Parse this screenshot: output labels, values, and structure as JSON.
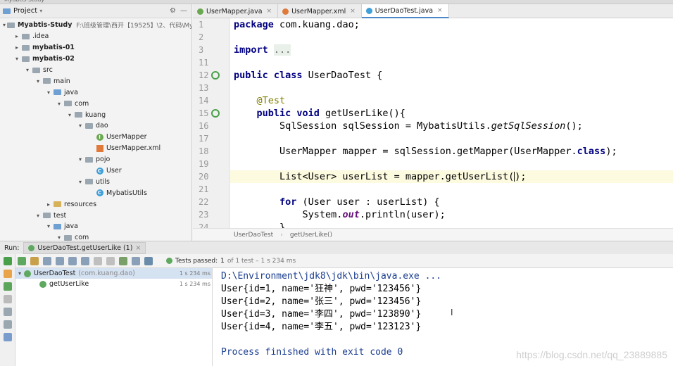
{
  "project_panel": {
    "title": "Project",
    "tree": [
      {
        "label": "Myabtis-Study",
        "path": "F:\\班级管理\\西开【19525】\\2、代码\\My",
        "bold": true,
        "indent": 0,
        "arrow": "▾",
        "icon": "folder"
      },
      {
        "label": ".idea",
        "indent": 1,
        "arrow": "▸",
        "icon": "folder"
      },
      {
        "label": "mybatis-01",
        "bold": true,
        "indent": 1,
        "arrow": "▸",
        "icon": "folder"
      },
      {
        "label": "mybatis-02",
        "bold": true,
        "indent": 1,
        "arrow": "▾",
        "icon": "folder"
      },
      {
        "label": "src",
        "indent": 2,
        "arrow": "▾",
        "icon": "folder"
      },
      {
        "label": "main",
        "indent": 3,
        "arrow": "▾",
        "icon": "folder"
      },
      {
        "label": "java",
        "indent": 4,
        "arrow": "▾",
        "icon": "folder-blue"
      },
      {
        "label": "com",
        "indent": 5,
        "arrow": "▾",
        "icon": "folder"
      },
      {
        "label": "kuang",
        "indent": 6,
        "arrow": "▾",
        "icon": "folder"
      },
      {
        "label": "dao",
        "indent": 7,
        "arrow": "▾",
        "icon": "folder"
      },
      {
        "label": "UserMapper",
        "indent": 8,
        "arrow": "",
        "icon": "interface"
      },
      {
        "label": "UserMapper.xml",
        "indent": 8,
        "arrow": "",
        "icon": "xml"
      },
      {
        "label": "pojo",
        "indent": 7,
        "arrow": "▾",
        "icon": "folder"
      },
      {
        "label": "User",
        "indent": 8,
        "arrow": "",
        "icon": "class"
      },
      {
        "label": "utils",
        "indent": 7,
        "arrow": "▾",
        "icon": "folder"
      },
      {
        "label": "MybatisUtils",
        "indent": 8,
        "arrow": "",
        "icon": "class"
      },
      {
        "label": "resources",
        "indent": 4,
        "arrow": "▸",
        "icon": "folder-yellow"
      },
      {
        "label": "test",
        "indent": 3,
        "arrow": "▾",
        "icon": "folder"
      },
      {
        "label": "java",
        "indent": 4,
        "arrow": "▾",
        "icon": "folder-blue"
      },
      {
        "label": "com",
        "indent": 5,
        "arrow": "▾",
        "icon": "folder"
      }
    ]
  },
  "editor": {
    "tabs": [
      {
        "label": "UserMapper.java",
        "active": false,
        "color": "#6aa84f"
      },
      {
        "label": "UserMapper.xml",
        "active": false,
        "color": "#e07a3b"
      },
      {
        "label": "UserDaoTest.java",
        "active": true,
        "color": "#3f9fd8"
      }
    ],
    "line_numbers": [
      "1",
      "2",
      "3",
      "11",
      "12",
      "13",
      "14",
      "15",
      "16",
      "17",
      "18",
      "19",
      "20",
      "21",
      "22",
      "23",
      "24"
    ],
    "run_markers": [
      "12",
      "15"
    ],
    "breadcrumb": [
      "UserDaoTest",
      "getUserLike()"
    ]
  },
  "run_panel": {
    "run_label": "Run:",
    "config_tab": "UserDaoTest.getUserLike (1)",
    "status": {
      "label": "Tests passed:",
      "count": "1",
      "detail": "of 1 test – 1 s 234 ms"
    },
    "tests": [
      {
        "name": "UserDaoTest",
        "pkg": "(com.kuang.dao)",
        "time": "1 s 234 ms",
        "selected": true
      },
      {
        "name": "getUserLike",
        "pkg": "",
        "time": "1 s 234 ms",
        "selected": false
      }
    ],
    "console": [
      {
        "text": "D:\\Environment\\jdk8\\jdk\\bin\\java.exe ...",
        "blue": true
      },
      {
        "text": "User{id=1, name='狂神', pwd='123456'}",
        "blue": false
      },
      {
        "text": "User{id=2, name='张三', pwd='123456'}",
        "blue": false
      },
      {
        "text": "User{id=3, name='李四', pwd='123890'}",
        "blue": false
      },
      {
        "text": "User{id=4, name='李五', pwd='123123'}",
        "blue": false
      },
      {
        "text": "",
        "blue": false
      },
      {
        "text": "Process finished with exit code 0",
        "blue": true
      }
    ],
    "watermark": "https://blog.csdn.net/qq_23889885"
  }
}
